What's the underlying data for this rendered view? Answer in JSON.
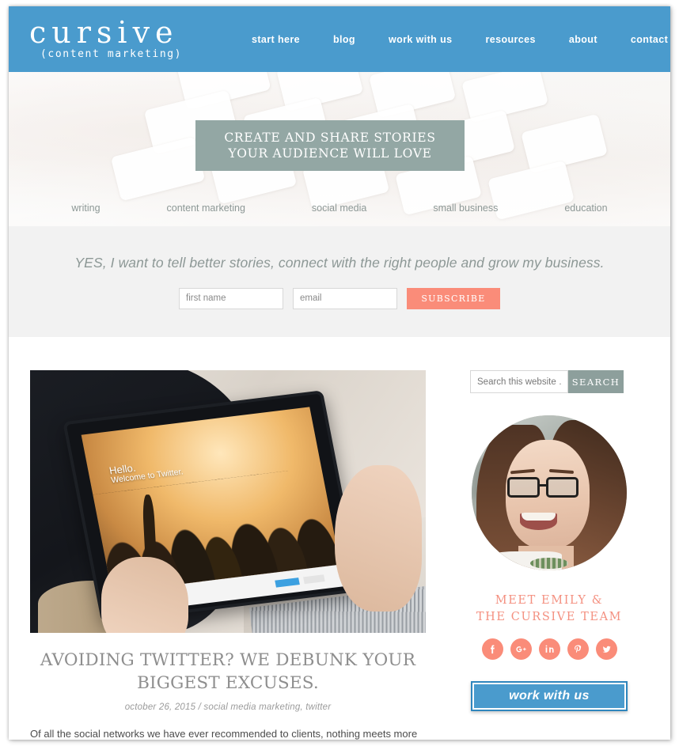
{
  "site": {
    "brand_name": "cursive",
    "brand_tagline": "(content marketing)"
  },
  "nav": {
    "items": [
      {
        "label": "start here"
      },
      {
        "label": "blog"
      },
      {
        "label": "work with us"
      },
      {
        "label": "resources"
      },
      {
        "label": "about"
      },
      {
        "label": "contact"
      }
    ]
  },
  "hero": {
    "banner_line1": "CREATE AND SHARE STORIES",
    "banner_line2": "YOUR AUDIENCE WILL LOVE",
    "banner_bg": "#93a7a4",
    "categories": [
      {
        "label": "writing"
      },
      {
        "label": "content marketing"
      },
      {
        "label": "social media"
      },
      {
        "label": "small business"
      },
      {
        "label": "education"
      }
    ]
  },
  "subscribe": {
    "headline": "YES, I want to tell better stories, connect with the right people and grow my business.",
    "first_name_placeholder": "first name",
    "first_name_value": "",
    "email_placeholder": "email",
    "email_value": "",
    "button_label": "SUBSCRIBE",
    "button_color": "#fa8c79",
    "background": "#f2f2f2"
  },
  "post": {
    "image_alt": "hands holding a tablet showing the Twitter welcome screen",
    "tablet_screen_greeting": "Hello.",
    "tablet_screen_subtext": "Welcome to Twitter.",
    "title": "AVOIDING TWITTER? WE DEBUNK YOUR BIGGEST EXCUSES.",
    "meta": "october 26, 2015 / social media marketing, twitter",
    "excerpt": "Of all the social networks we have ever recommended to clients, nothing meets more"
  },
  "sidebar": {
    "search_placeholder": "Search this website …",
    "search_value": "",
    "search_button_label": "SEARCH",
    "search_button_color": "#8d9f9c",
    "avatar_alt": "portrait of a smiling woman wearing glasses",
    "meet_line1": "MEET EMILY &",
    "meet_line2": "THE CURSIVE TEAM",
    "meet_color": "#f49080",
    "social": [
      {
        "name": "facebook-icon"
      },
      {
        "name": "google-plus-icon"
      },
      {
        "name": "linkedin-icon"
      },
      {
        "name": "pinterest-icon"
      },
      {
        "name": "twitter-icon"
      }
    ],
    "social_color": "#fa8c79",
    "work_button_label": "work with us",
    "work_button_color": "#4a9bcd"
  },
  "theme": {
    "header_blue": "#4a9bcd",
    "coral": "#fa8c79",
    "sage": "#93a7a4",
    "text_gray": "#8e8e8e"
  }
}
